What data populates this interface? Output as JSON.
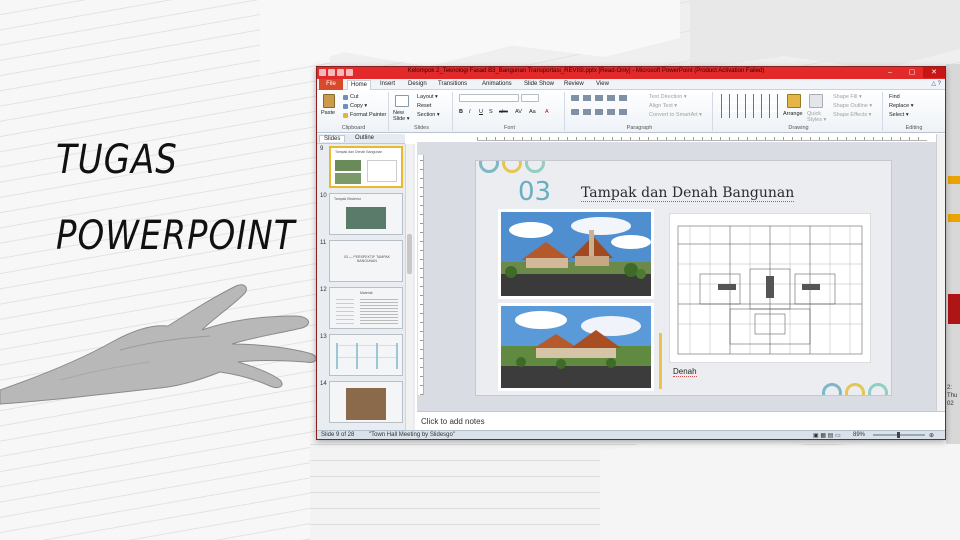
{
  "poster": {
    "line1": "TUGAS",
    "line2": "POWERPOINT"
  },
  "window": {
    "title": "Kelompok 2_Teknologi Fasad B3_Bangunan Transportasi_REVISI.pptx [Read-Only] - Microsoft PowerPoint (Product Activation Failed)",
    "controls": [
      "–",
      "▢",
      "✕"
    ]
  },
  "ribbon_tabs": [
    "File",
    "Home",
    "Insert",
    "Design",
    "Transitions",
    "Animations",
    "Slide Show",
    "Review",
    "View"
  ],
  "ribbon": {
    "clipboard": {
      "paste": "Paste",
      "cut": "Cut",
      "copy": "Copy ▾",
      "format_painter": "Format Painter",
      "label": "Clipboard"
    },
    "slides": {
      "new_slide": "New Slide ▾",
      "layout": "Layout ▾",
      "reset": "Reset",
      "section": "Section ▾",
      "label": "Slides"
    },
    "font": {
      "label": "Font",
      "buttons": [
        "B",
        "I",
        "U",
        "S",
        "abc",
        "AV",
        "Aa",
        "A"
      ]
    },
    "paragraph": {
      "text_direction": "Text Direction ▾",
      "align_text": "Align Text ▾",
      "convert_smartart": "Convert to SmartArt ▾",
      "label": "Paragraph"
    },
    "drawing": {
      "arrange": "Arrange",
      "quick_styles": "Quick Styles ▾",
      "shape_fill": "Shape Fill ▾",
      "shape_outline": "Shape Outline ▾",
      "shape_effects": "Shape Effects ▾",
      "label": "Drawing"
    },
    "editing": {
      "find": "Find",
      "replace": "Replace ▾",
      "select": "Select ▾",
      "label": "Editing"
    }
  },
  "pane_tabs": [
    "Slides",
    "Outline"
  ],
  "thumbnails": [
    {
      "num": "9",
      "caption": "Tampak dan Denah Bangunan"
    },
    {
      "num": "10",
      "caption": "Tampak Eksterior"
    },
    {
      "num": "11",
      "caption": "03 — PERSPEKTIF TAMPAK BANGUNAN"
    },
    {
      "num": "12",
      "caption": "Material"
    },
    {
      "num": "13",
      "caption": ""
    },
    {
      "num": "14",
      "caption": ""
    }
  ],
  "slide": {
    "number": "03",
    "title": "Tampak dan Denah Bangunan",
    "plan_caption": "Denah",
    "colors": {
      "blue": "#7fb6c8",
      "yellow": "#e6c653",
      "teal": "#8fcfc4"
    }
  },
  "notes_placeholder": "Click to add notes",
  "status": {
    "slide_indicator": "Slide 9 of 28",
    "theme": "\"Town Hall Meeting by Slidesgo\"",
    "zoom": "89%"
  },
  "peek_text": [
    "2:",
    "Thu",
    "02"
  ]
}
